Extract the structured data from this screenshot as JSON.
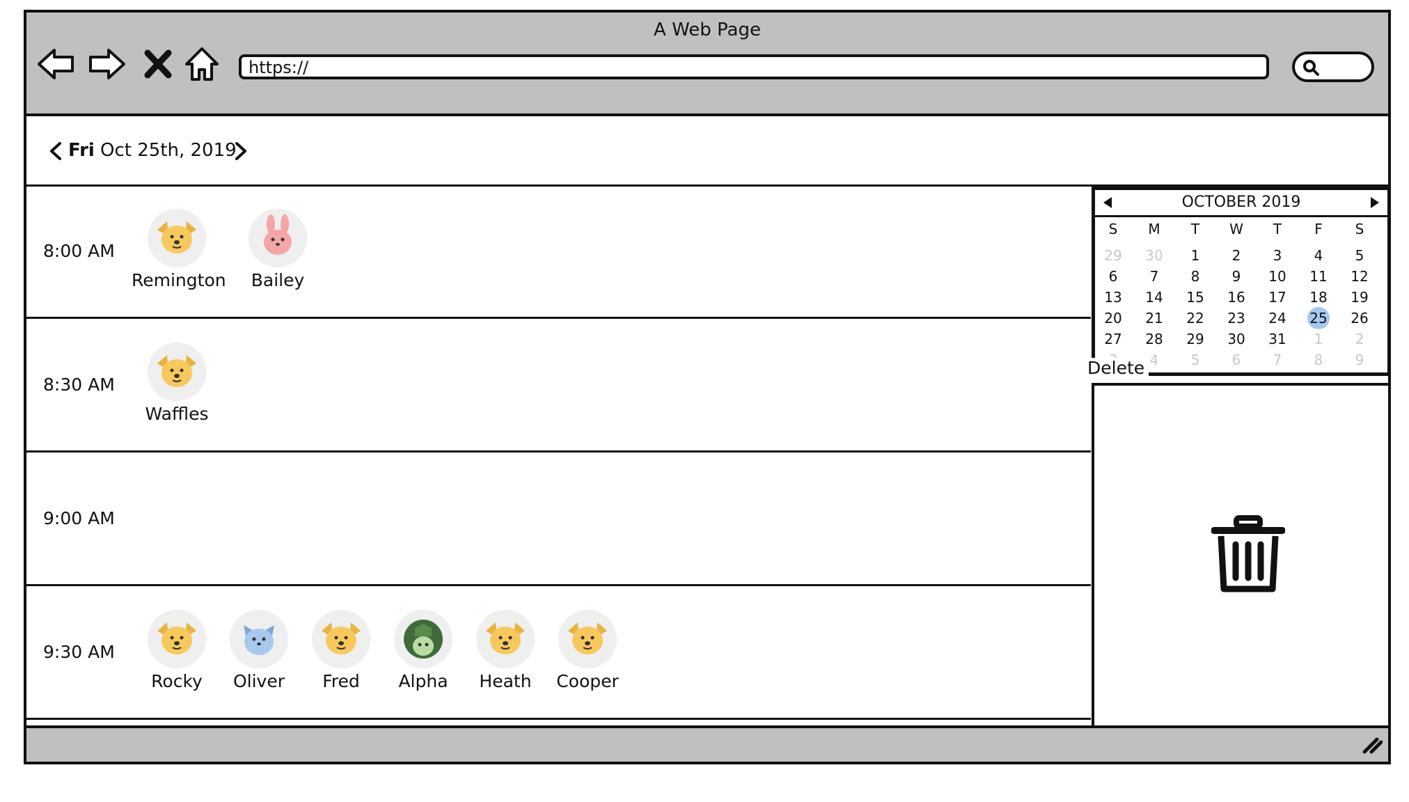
{
  "window": {
    "title": "A Web Page"
  },
  "toolbar": {
    "url": "https://"
  },
  "date_nav": {
    "day": "Fri",
    "date": "Oct 25th, 2019"
  },
  "slots": [
    {
      "time": "8:00 AM",
      "pets": [
        {
          "name": "Remington",
          "icon": "dog-icon"
        },
        {
          "name": "Bailey",
          "icon": "rabbit-icon"
        }
      ]
    },
    {
      "time": "8:30 AM",
      "pets": [
        {
          "name": "Waffles",
          "icon": "dog-icon"
        }
      ]
    },
    {
      "time": "9:00 AM",
      "pets": []
    },
    {
      "time": "9:30 AM",
      "pets": [
        {
          "name": "Rocky",
          "icon": "dog-icon"
        },
        {
          "name": "Oliver",
          "icon": "cat-icon"
        },
        {
          "name": "Fred",
          "icon": "dog-icon"
        },
        {
          "name": "Alpha",
          "icon": "turtle-icon"
        },
        {
          "name": "Heath",
          "icon": "dog-icon"
        },
        {
          "name": "Cooper",
          "icon": "dog-icon"
        }
      ]
    }
  ],
  "calendar": {
    "month": "OCTOBER 2019",
    "weekdays": [
      "S",
      "M",
      "T",
      "W",
      "T",
      "F",
      "S"
    ],
    "weeks": [
      [
        {
          "d": "29",
          "m": true
        },
        {
          "d": "30",
          "m": true
        },
        {
          "d": "1"
        },
        {
          "d": "2"
        },
        {
          "d": "3"
        },
        {
          "d": "4"
        },
        {
          "d": "5"
        }
      ],
      [
        {
          "d": "6"
        },
        {
          "d": "7"
        },
        {
          "d": "8"
        },
        {
          "d": "9"
        },
        {
          "d": "10"
        },
        {
          "d": "11"
        },
        {
          "d": "12"
        }
      ],
      [
        {
          "d": "13"
        },
        {
          "d": "14"
        },
        {
          "d": "15"
        },
        {
          "d": "16"
        },
        {
          "d": "17"
        },
        {
          "d": "18"
        },
        {
          "d": "19"
        }
      ],
      [
        {
          "d": "20"
        },
        {
          "d": "21"
        },
        {
          "d": "22"
        },
        {
          "d": "23"
        },
        {
          "d": "24"
        },
        {
          "d": "25",
          "s": true
        },
        {
          "d": "26"
        }
      ],
      [
        {
          "d": "27"
        },
        {
          "d": "28"
        },
        {
          "d": "29"
        },
        {
          "d": "30"
        },
        {
          "d": "31"
        },
        {
          "d": "1",
          "m": true
        },
        {
          "d": "2",
          "m": true
        }
      ],
      [
        {
          "d": "3",
          "m": true
        },
        {
          "d": "4",
          "m": true
        },
        {
          "d": "5",
          "m": true
        },
        {
          "d": "6",
          "m": true
        },
        {
          "d": "7",
          "m": true
        },
        {
          "d": "8",
          "m": true
        },
        {
          "d": "9",
          "m": true
        }
      ]
    ]
  },
  "delete_panel": {
    "label": "Delete",
    "icon": "trash-icon"
  },
  "colors": {
    "chrome": "#c0c0c0",
    "selected_day": "#a8c8f0",
    "dog": "#f7c95c",
    "rabbit": "#f4a5a8",
    "cat": "#a9c8ee",
    "turtle": "#3f6b3a"
  }
}
